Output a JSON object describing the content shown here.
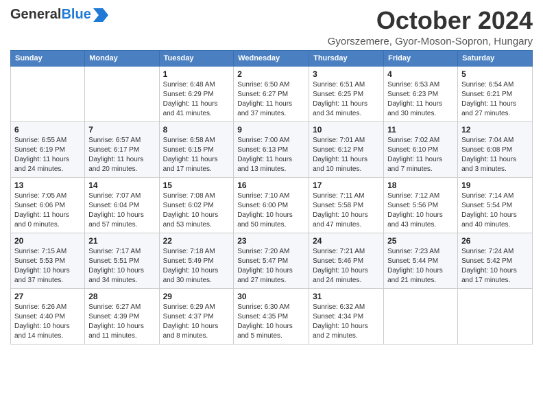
{
  "header": {
    "logo_general": "General",
    "logo_blue": "Blue",
    "title": "October 2024",
    "subtitle": "Gyorszemere, Gyor-Moson-Sopron, Hungary"
  },
  "days_of_week": [
    "Sunday",
    "Monday",
    "Tuesday",
    "Wednesday",
    "Thursday",
    "Friday",
    "Saturday"
  ],
  "weeks": [
    [
      {
        "day": "",
        "info": ""
      },
      {
        "day": "",
        "info": ""
      },
      {
        "day": "1",
        "info": "Sunrise: 6:48 AM\nSunset: 6:29 PM\nDaylight: 11 hours and 41 minutes."
      },
      {
        "day": "2",
        "info": "Sunrise: 6:50 AM\nSunset: 6:27 PM\nDaylight: 11 hours and 37 minutes."
      },
      {
        "day": "3",
        "info": "Sunrise: 6:51 AM\nSunset: 6:25 PM\nDaylight: 11 hours and 34 minutes."
      },
      {
        "day": "4",
        "info": "Sunrise: 6:53 AM\nSunset: 6:23 PM\nDaylight: 11 hours and 30 minutes."
      },
      {
        "day": "5",
        "info": "Sunrise: 6:54 AM\nSunset: 6:21 PM\nDaylight: 11 hours and 27 minutes."
      }
    ],
    [
      {
        "day": "6",
        "info": "Sunrise: 6:55 AM\nSunset: 6:19 PM\nDaylight: 11 hours and 24 minutes."
      },
      {
        "day": "7",
        "info": "Sunrise: 6:57 AM\nSunset: 6:17 PM\nDaylight: 11 hours and 20 minutes."
      },
      {
        "day": "8",
        "info": "Sunrise: 6:58 AM\nSunset: 6:15 PM\nDaylight: 11 hours and 17 minutes."
      },
      {
        "day": "9",
        "info": "Sunrise: 7:00 AM\nSunset: 6:13 PM\nDaylight: 11 hours and 13 minutes."
      },
      {
        "day": "10",
        "info": "Sunrise: 7:01 AM\nSunset: 6:12 PM\nDaylight: 11 hours and 10 minutes."
      },
      {
        "day": "11",
        "info": "Sunrise: 7:02 AM\nSunset: 6:10 PM\nDaylight: 11 hours and 7 minutes."
      },
      {
        "day": "12",
        "info": "Sunrise: 7:04 AM\nSunset: 6:08 PM\nDaylight: 11 hours and 3 minutes."
      }
    ],
    [
      {
        "day": "13",
        "info": "Sunrise: 7:05 AM\nSunset: 6:06 PM\nDaylight: 11 hours and 0 minutes."
      },
      {
        "day": "14",
        "info": "Sunrise: 7:07 AM\nSunset: 6:04 PM\nDaylight: 10 hours and 57 minutes."
      },
      {
        "day": "15",
        "info": "Sunrise: 7:08 AM\nSunset: 6:02 PM\nDaylight: 10 hours and 53 minutes."
      },
      {
        "day": "16",
        "info": "Sunrise: 7:10 AM\nSunset: 6:00 PM\nDaylight: 10 hours and 50 minutes."
      },
      {
        "day": "17",
        "info": "Sunrise: 7:11 AM\nSunset: 5:58 PM\nDaylight: 10 hours and 47 minutes."
      },
      {
        "day": "18",
        "info": "Sunrise: 7:12 AM\nSunset: 5:56 PM\nDaylight: 10 hours and 43 minutes."
      },
      {
        "day": "19",
        "info": "Sunrise: 7:14 AM\nSunset: 5:54 PM\nDaylight: 10 hours and 40 minutes."
      }
    ],
    [
      {
        "day": "20",
        "info": "Sunrise: 7:15 AM\nSunset: 5:53 PM\nDaylight: 10 hours and 37 minutes."
      },
      {
        "day": "21",
        "info": "Sunrise: 7:17 AM\nSunset: 5:51 PM\nDaylight: 10 hours and 34 minutes."
      },
      {
        "day": "22",
        "info": "Sunrise: 7:18 AM\nSunset: 5:49 PM\nDaylight: 10 hours and 30 minutes."
      },
      {
        "day": "23",
        "info": "Sunrise: 7:20 AM\nSunset: 5:47 PM\nDaylight: 10 hours and 27 minutes."
      },
      {
        "day": "24",
        "info": "Sunrise: 7:21 AM\nSunset: 5:46 PM\nDaylight: 10 hours and 24 minutes."
      },
      {
        "day": "25",
        "info": "Sunrise: 7:23 AM\nSunset: 5:44 PM\nDaylight: 10 hours and 21 minutes."
      },
      {
        "day": "26",
        "info": "Sunrise: 7:24 AM\nSunset: 5:42 PM\nDaylight: 10 hours and 17 minutes."
      }
    ],
    [
      {
        "day": "27",
        "info": "Sunrise: 6:26 AM\nSunset: 4:40 PM\nDaylight: 10 hours and 14 minutes."
      },
      {
        "day": "28",
        "info": "Sunrise: 6:27 AM\nSunset: 4:39 PM\nDaylight: 10 hours and 11 minutes."
      },
      {
        "day": "29",
        "info": "Sunrise: 6:29 AM\nSunset: 4:37 PM\nDaylight: 10 hours and 8 minutes."
      },
      {
        "day": "30",
        "info": "Sunrise: 6:30 AM\nSunset: 4:35 PM\nDaylight: 10 hours and 5 minutes."
      },
      {
        "day": "31",
        "info": "Sunrise: 6:32 AM\nSunset: 4:34 PM\nDaylight: 10 hours and 2 minutes."
      },
      {
        "day": "",
        "info": ""
      },
      {
        "day": "",
        "info": ""
      }
    ]
  ]
}
